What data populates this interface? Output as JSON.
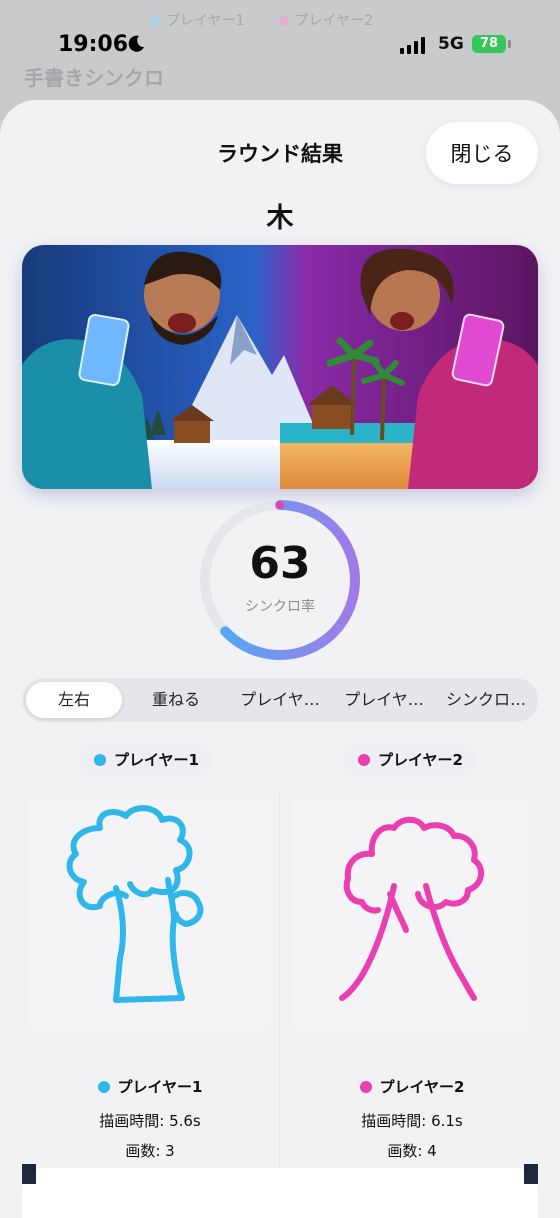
{
  "status_bar": {
    "time": "19:06",
    "network": "5G",
    "battery": "78"
  },
  "background": {
    "legend": [
      "プレイヤー1",
      "プレイヤー2"
    ],
    "title": "手書きシンクロ"
  },
  "sheet": {
    "title": "ラウンド結果",
    "close_label": "閉じる",
    "topic": "木"
  },
  "sync": {
    "score": "63",
    "label": "シンクロ率",
    "fraction": 0.63
  },
  "tabs": [
    {
      "label": "左右",
      "active": true
    },
    {
      "label": "重ねる",
      "active": false
    },
    {
      "label": "プレイヤ…",
      "active": false
    },
    {
      "label": "プレイヤ…",
      "active": false
    },
    {
      "label": "シンクロ…",
      "active": false
    }
  ],
  "players": [
    {
      "name": "プレイヤー1",
      "color": "#2fb6ea",
      "draw_time": "描画時間: 5.6s",
      "strokes": "画数: 3"
    },
    {
      "name": "プレイヤー2",
      "color": "#ea3fb0",
      "draw_time": "描画時間: 6.1s",
      "strokes": "画数: 4"
    }
  ],
  "colors": {
    "ring_start": "#4aaef5",
    "ring_end": "#a07be8",
    "ring_track": "#e6e6ea",
    "ring_tip": "#ea3fb0"
  }
}
